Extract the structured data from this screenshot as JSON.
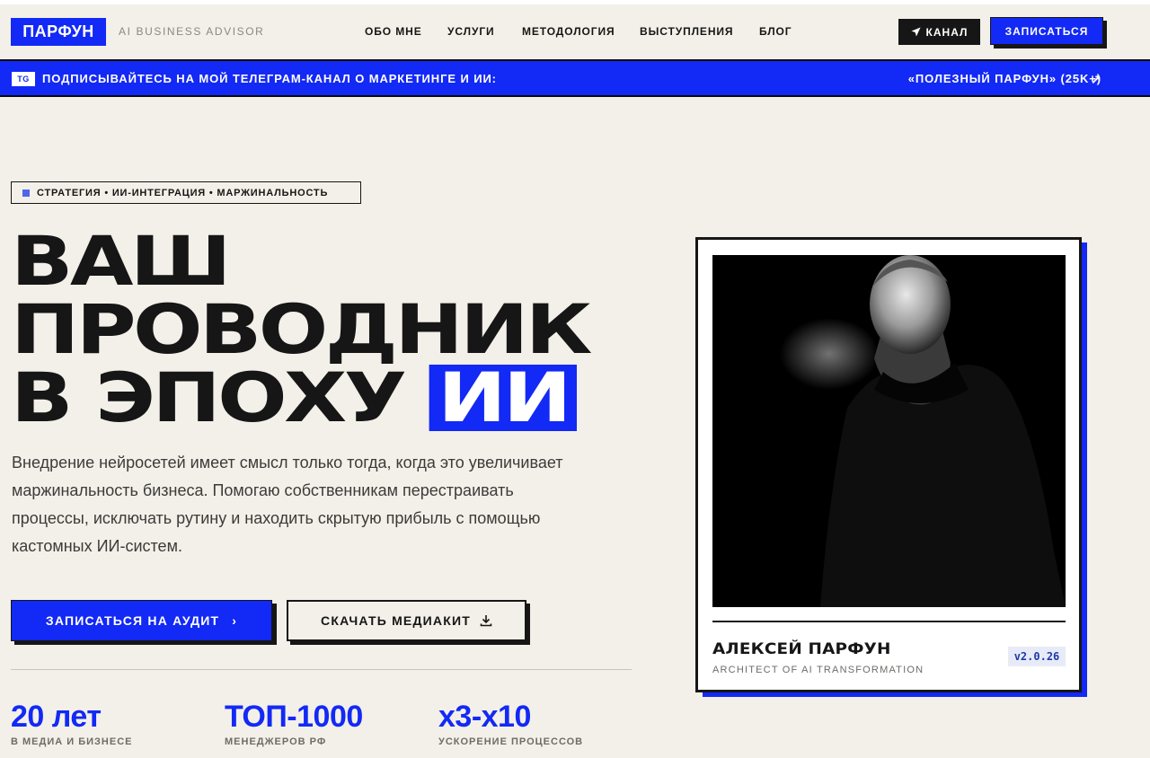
{
  "header": {
    "logo": "ПАРФУН",
    "tagline": "AI BUSINESS ADVISOR",
    "nav": [
      "ОБО МНЕ",
      "УСЛУГИ",
      "МЕТОДОЛОГИЯ",
      "ВЫСТУПЛЕНИЯ",
      "БЛОГ"
    ],
    "channel_button": "КАНАЛ",
    "signup_button": "ЗАПИСАТЬСЯ"
  },
  "banner": {
    "badge": "TG",
    "text": "ПОДПИСЫВАЙТЕСЬ НА МОЙ ТЕЛЕГРАМ-КАНАЛ О МАРКЕТИНГЕ И ИИ:",
    "link": "«ПОЛЕЗНЫЙ ПАРФУН» (25K+)",
    "arrow": "↗"
  },
  "hero": {
    "chip": "СТРАТЕГИЯ • ИИ-ИНТЕГРАЦИЯ • МАРЖИНАЛЬНОСТЬ",
    "title_line1": "ВАШ",
    "title_line2": "ПРОВОДНИК",
    "title_line3": "В ЭПОХУ",
    "title_highlight": "ИИ",
    "description": "Внедрение нейросетей имеет смысл только тогда, когда это увеличивает маржинальность бизнеса. Помогаю собственникам перестраивать процессы, исключать рутину и находить скрытую прибыль с помощью кастомных ИИ-систем.",
    "primary_button": "ЗАПИСАТЬСЯ НА АУДИТ",
    "primary_button_icon": "›",
    "secondary_button": "СКАЧАТЬ МЕДИАКИТ"
  },
  "stats": [
    {
      "value": "20 лет",
      "label": "В МЕДИА И БИЗНЕСЕ"
    },
    {
      "value": "ТОП-1000",
      "label": "МЕНЕДЖЕРОВ РФ"
    },
    {
      "value": "x3-x10",
      "label": "УСКОРЕНИЕ ПРОЦЕССОВ"
    }
  ],
  "card": {
    "name": "АЛЕКСЕЙ ПАРФУН",
    "role": "ARCHITECT OF AI TRANSFORMATION",
    "version": "v2.0.26"
  },
  "colors": {
    "accent": "#1329f5",
    "background": "#f3f0e9",
    "ink": "#161616"
  },
  "icons": [
    "send-icon",
    "arrow-up-right-icon",
    "chevron-right-icon",
    "download-icon"
  ]
}
